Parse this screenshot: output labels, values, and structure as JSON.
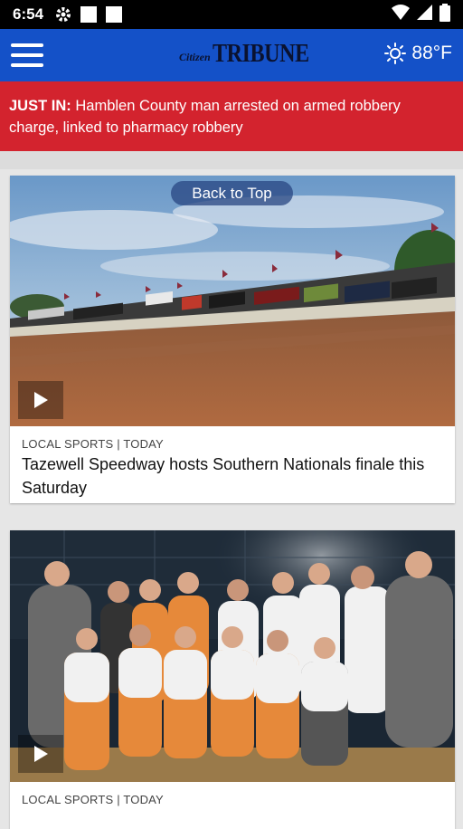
{
  "status_bar": {
    "time": "6:54"
  },
  "app_bar": {
    "logo_small": "Citizen",
    "logo_big": "TRIBUNE",
    "weather_temp": "88°F"
  },
  "breaking": {
    "prefix": "JUST IN:",
    "text": "Hamblen County man arrested on armed robbery charge, linked to pharmacy robbery"
  },
  "back_to_top": "Back to Top",
  "articles": [
    {
      "meta": "LOCAL SPORTS | TODAY",
      "headline": "Tazewell Speedway hosts Southern Nationals finale this Saturday"
    },
    {
      "meta": "LOCAL SPORTS | TODAY",
      "headline": ""
    }
  ],
  "colors": {
    "app_bar": "#1451c8",
    "breaking": "#d3232e",
    "background": "#e6e6e6"
  }
}
